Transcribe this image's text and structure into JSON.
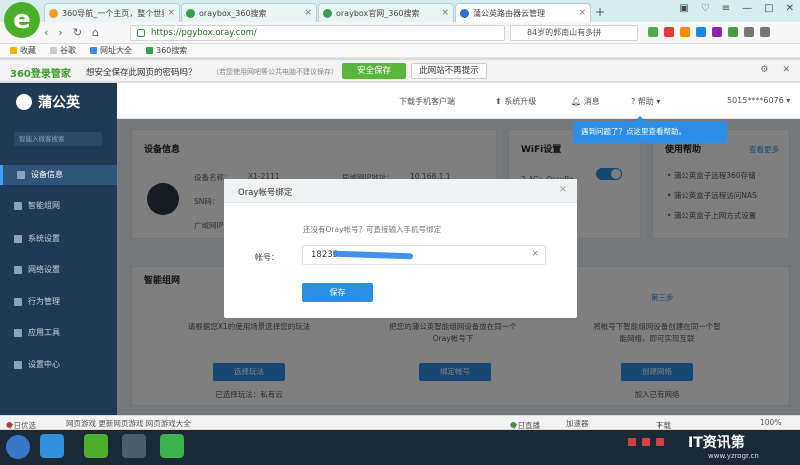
{
  "browser": {
    "tabs": [
      {
        "label": "360导航_一个主页，整个世界",
        "color": "#f0a020"
      },
      {
        "label": "oraybox_360搜索",
        "color": "#3aa050"
      },
      {
        "label": "oraybox官网_360搜索",
        "color": "#3aa050"
      },
      {
        "label": "蒲公英路由器云管理",
        "color": "#2d6ecf"
      }
    ],
    "new_tab": "+",
    "url": "https://pgybox.oray.com/",
    "search_text": "84岁的郭南山有多拼",
    "bookmarks": [
      "收藏",
      "谷歌",
      "网址大全",
      "360搜索"
    ]
  },
  "password_bar": {
    "brand": "360登录管家",
    "question": "想安全保存此网页的密码吗？",
    "hint": "（若您使用网吧等公共电脑不建议保存）",
    "save_label": "安全保存",
    "never_label": "此网站不再提示"
  },
  "app": {
    "brand": "蒲公英",
    "sidebar_search_placeholder": "智能入微客搜索",
    "sidebar_items": [
      "设备信息",
      "智能组网",
      "系统设置",
      "网络设置",
      "行为管理",
      "应用工具",
      "设置中心"
    ],
    "topnav": {
      "download": "下载手机客户端",
      "upgrade": "系统升级",
      "messages": "消息",
      "help": "帮助",
      "account": "5015****6076"
    },
    "tooltip": "遇到问题了？点这里查看帮助。",
    "device_card": {
      "title": "设备信息",
      "name_label": "设备名称：",
      "name_value": "X1-2111",
      "lan_label": "局域网IP地址：",
      "lan_value": "10.168.1.1",
      "sn_label": "SN码：",
      "wan_label": "广域网IP："
    },
    "wifi_card": {
      "title": "WiFi设置",
      "band": "2.4G：OrayBo"
    },
    "help_card": {
      "title": "使用帮助",
      "more": "查看更多",
      "items": [
        "蒲公英盒子远程360存储",
        "蒲公英盒子远程访问NAS",
        "蒲公英盒子上网方式设置"
      ]
    },
    "network_card": {
      "title": "智能组网",
      "step3": "第三步",
      "steps": [
        {
          "text": "请根据您X1的使用场景选择您的玩法",
          "button": "选择玩法",
          "note": "已选择玩法：私有云"
        },
        {
          "text": "把您的蒲公英智能组网设备放在同一个Oray帐号下",
          "button": "绑定帐号",
          "note": ""
        },
        {
          "text": "将帐号下智能组网设备创建在同一个智能网络，即可实现互联",
          "button": "创建网络",
          "note": "加入已有网络"
        }
      ]
    }
  },
  "modal": {
    "title": "Oray帐号绑定",
    "close": "×",
    "hint": "还没有Oray帐号？可直接输入手机号绑定",
    "account_label": "帐号：",
    "account_value": "18235",
    "clear": "×",
    "save_label": "保存"
  },
  "status_bar": {
    "left": "今日优选",
    "news": "网页游戏 更新网页游戏 网页游戏大全",
    "live": "今日直播",
    "speed": "加速器",
    "download": "下载",
    "zoom": "100%"
  },
  "watermark": {
    "main": "IT资讯第",
    "sub": "www.yzrogr.cn"
  },
  "colors": {
    "accent": "#2d8ee6",
    "sidebar": "#1f3a55",
    "green": "#59b53c"
  }
}
